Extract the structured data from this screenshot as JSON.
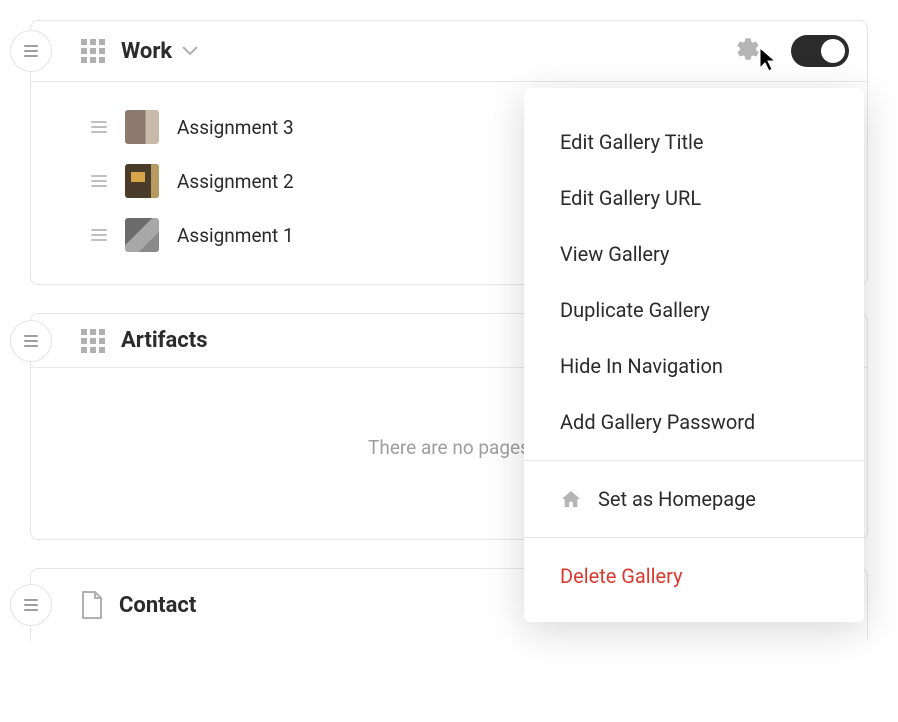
{
  "sections": {
    "work": {
      "title": "Work",
      "items": [
        {
          "label": "Assignment 3"
        },
        {
          "label": "Assignment 2"
        },
        {
          "label": "Assignment 1"
        }
      ]
    },
    "artifacts": {
      "title": "Artifacts",
      "empty_message": "There are no pages"
    },
    "contact": {
      "title": "Contact"
    }
  },
  "menu": {
    "edit_title": "Edit Gallery Title",
    "edit_url": "Edit Gallery URL",
    "view": "View Gallery",
    "duplicate": "Duplicate Gallery",
    "hide_nav": "Hide In Navigation",
    "add_password": "Add Gallery Password",
    "set_homepage": "Set as Homepage",
    "delete": "Delete Gallery"
  }
}
